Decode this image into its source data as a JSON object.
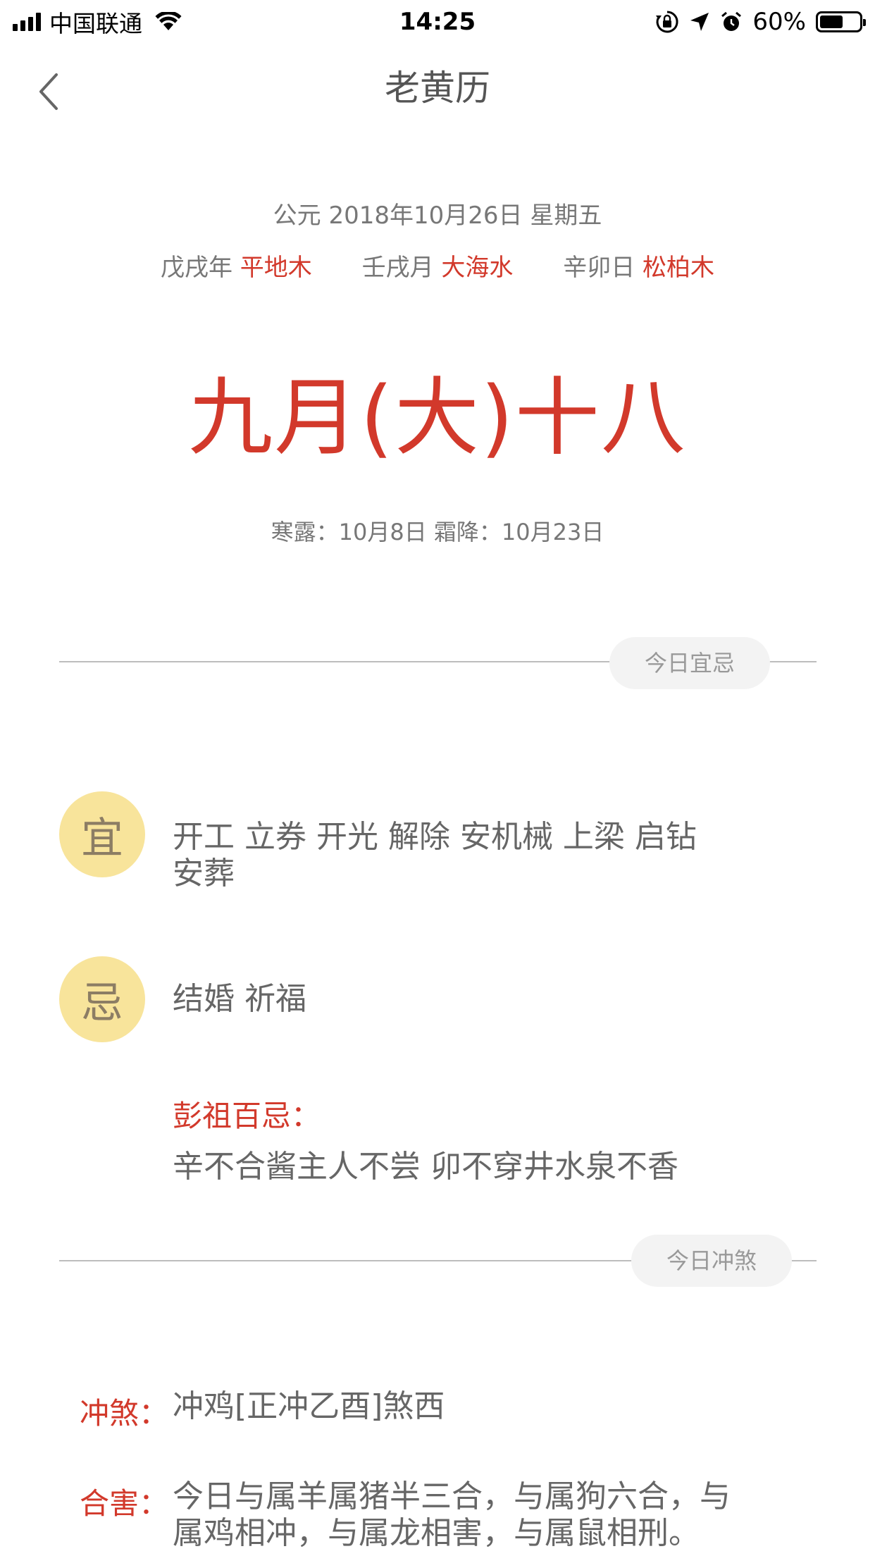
{
  "status_bar": {
    "carrier": "中国联通",
    "time": "14:25",
    "battery_percent": "60%",
    "battery_level": 0.6,
    "icons": [
      "signal-icon",
      "wifi-icon",
      "rotation-lock-icon",
      "location-arrow-icon",
      "alarm-icon",
      "battery-icon"
    ]
  },
  "nav": {
    "title": "老黄历",
    "back_icon": "chevron-left-icon"
  },
  "header": {
    "gregorian": "公元 2018年10月26日 星期五",
    "year_ganzhi": "戊戌年",
    "year_element": "平地木",
    "month_ganzhi": "壬戌月",
    "month_element": "大海水",
    "day_ganzhi": "辛卯日",
    "day_element": "松柏木",
    "lunar_date": "九月(大)十八",
    "solar_terms": "寒露：10月8日 霜降：10月23日"
  },
  "section_yiji": {
    "title": "今日宜忌",
    "yi_label": "宜",
    "yi_line1": "开工 立券 开光 解除 安机械 上梁 启钻",
    "yi_line2": "安葬",
    "ji_label": "忌",
    "ji_text": "结婚 祈福",
    "pengzu_label": "彭祖百忌：",
    "pengzu_text": "辛不合酱主人不尝 卯不穿井水泉不香"
  },
  "section_chongsha": {
    "title": "今日冲煞",
    "chongsha_label": "冲煞：",
    "chongsha_text": "冲鸡[正冲乙酉]煞西",
    "hehai_label": "合害：",
    "hehai_line1": "今日与属羊属猪半三合，与属狗六合，与",
    "hehai_line2": "属鸡相冲，与属龙相害，与属鼠相刑。"
  },
  "colors": {
    "accent_red": "#d2392b",
    "badge_yellow": "#f8e49b",
    "pill_bg": "#f3f3f3"
  }
}
